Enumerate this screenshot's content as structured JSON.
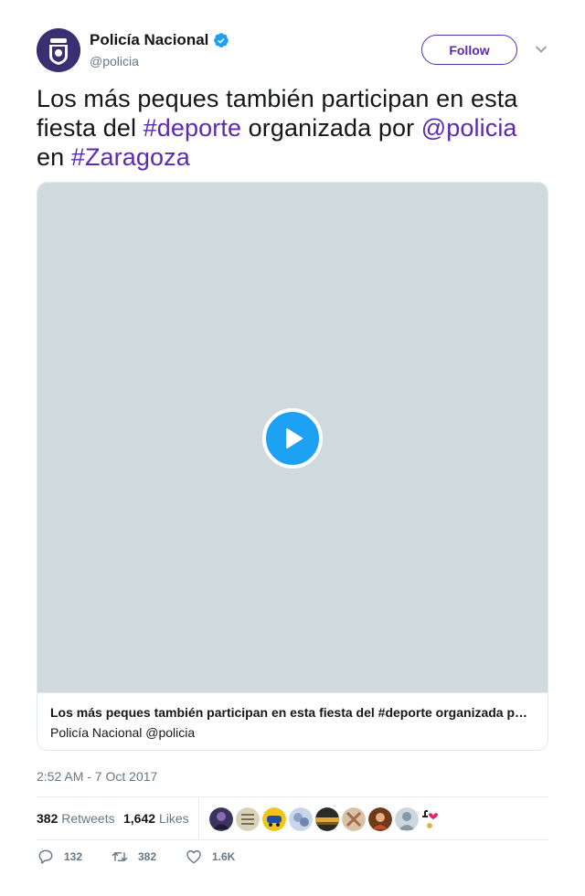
{
  "account": {
    "display_name": "Policía Nacional",
    "handle": "@policia",
    "verified": true,
    "avatar_icon": "police-badge-icon",
    "follow_label": "Follow"
  },
  "tweet": {
    "parts": [
      {
        "text": "Los más peques también participan en esta fiesta del ",
        "link": false
      },
      {
        "text": "#deporte",
        "link": true
      },
      {
        "text": " organizada por ",
        "link": false
      },
      {
        "text": "@policia",
        "link": true
      },
      {
        "text": " en ",
        "link": false
      },
      {
        "text": "#Zaragoza",
        "link": true
      }
    ],
    "timestamp": "2:52 AM - 7 Oct 2017"
  },
  "media": {
    "play_icon": "play-icon",
    "card_title": "Los más peques también participan en esta fiesta del #deporte organizada p…",
    "card_source": "Policía Nacional @policia"
  },
  "stats": {
    "retweets_count": "382",
    "retweets_label": "Retweets",
    "likes_count": "1,642",
    "likes_label": "Likes",
    "likers_count_shown": 9
  },
  "actions": {
    "reply_count": "132",
    "retweet_count": "382",
    "like_count": "1.6K"
  },
  "colors": {
    "link": "#5c2ab0",
    "verified": "#1da1f2",
    "play_button": "#1da1f2",
    "video_placeholder": "#cfd9de",
    "muted_text": "#657786"
  }
}
